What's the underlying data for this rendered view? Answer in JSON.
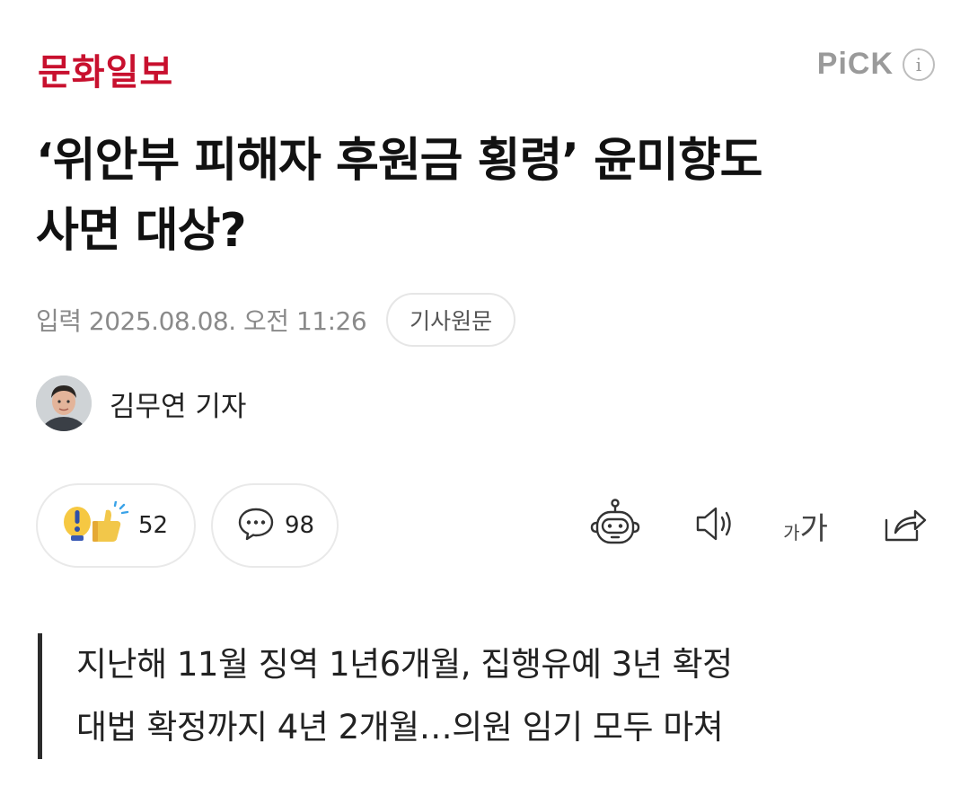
{
  "header": {
    "logo": "문화일보",
    "pick_label": "PiCK",
    "info_icon": "i"
  },
  "article": {
    "title_line1": "‘위안부 피해자 후원금 횡령’ 윤미향도",
    "title_line2": "사면 대상?",
    "date": "입력 2025.08.08. 오전 11:26",
    "source_button": "기사원문",
    "author": "김무연 기자"
  },
  "actions": {
    "reaction_count": "52",
    "comment_count": "98",
    "font_small": "가",
    "font_large": "가",
    "icons": [
      "reaction-icon",
      "comment-icon",
      "ai-bot-icon",
      "speaker-icon",
      "font-size-icon",
      "share-icon"
    ]
  },
  "summary": {
    "line1": "지난해 11월 징역 1년6개월, 집행유예 3년 확정",
    "line2": "대법 확정까지 4년 2개월…의원 임기 모두 마쳐"
  }
}
